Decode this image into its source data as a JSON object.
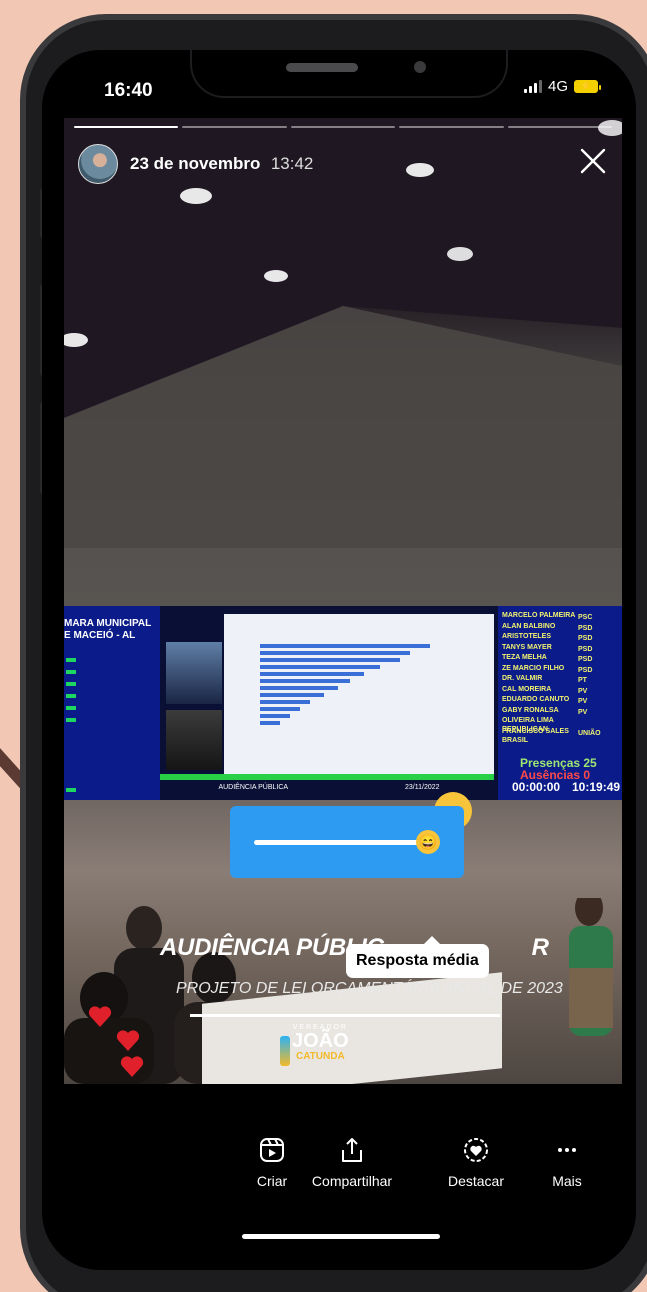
{
  "status_bar": {
    "time": "16:40",
    "network": "4G"
  },
  "story": {
    "date": "23 de novembro",
    "time": "13:42",
    "segments_total": 5,
    "segment_active": 1,
    "close_icon": "close-icon"
  },
  "screen_content": {
    "panel_left_title": "MARA MUNICIPAL\nE MACEIÓ - AL",
    "presences": "Presenças 25",
    "absences": "Ausências  0",
    "clock_left": "00:00:00",
    "clock_right": "10:19:49",
    "bottom_label": "AUDIÊNCIA PÚBLICA",
    "bottom_date": "23/11/2022",
    "council_members": [
      {
        "name": "MARCELO PALMEIRA",
        "party": "PSC"
      },
      {
        "name": "ALAN BALBINO",
        "party": "PSD"
      },
      {
        "name": "ARISTÓTELES",
        "party": "PSD"
      },
      {
        "name": "TANYS MAYER",
        "party": "PSD"
      },
      {
        "name": "TEZA MELHA",
        "party": "PSD"
      },
      {
        "name": "ZÉ MÁRCIO FILHO",
        "party": "PSD"
      },
      {
        "name": "DR. VALMIR",
        "party": "PT"
      },
      {
        "name": "CAL MOREIRA",
        "party": "PV"
      },
      {
        "name": "EDUARDO CANUTO",
        "party": "PV"
      },
      {
        "name": "GABY RONALSA",
        "party": "PV"
      },
      {
        "name": "OLIVEIRA LIMA",
        "party": "REPUBLICAN"
      },
      {
        "name": "FRANCISCO SALES",
        "party": "UNIÃO BRASIL"
      }
    ]
  },
  "slider_sticker": {
    "emoji": "😄",
    "average_value": 0.85
  },
  "tooltip": {
    "label": "Resposta média"
  },
  "overlay": {
    "headline": "AUDIÊNCIA PÚBLIC",
    "headline_tail": "R",
    "subline": "PROJETO DE LEI ORÇAMENTÁRIA ANUAL DE 2023",
    "logo": {
      "vereador": "VEREADOR",
      "name": "JOÃO",
      "surname": "CATUNDA"
    }
  },
  "actions": [
    {
      "label": "Criar",
      "icon": "reels-create-icon"
    },
    {
      "label": "Compartilhar",
      "icon": "share-icon"
    },
    {
      "label": "Destacar",
      "icon": "highlight-heart-icon"
    },
    {
      "label": "Mais",
      "icon": "more-dots-icon"
    }
  ],
  "colors": {
    "background": "#f2c8b4",
    "slider": "#2e9bf2",
    "emoji": "#f7c43a",
    "heart": "#e0202a"
  }
}
